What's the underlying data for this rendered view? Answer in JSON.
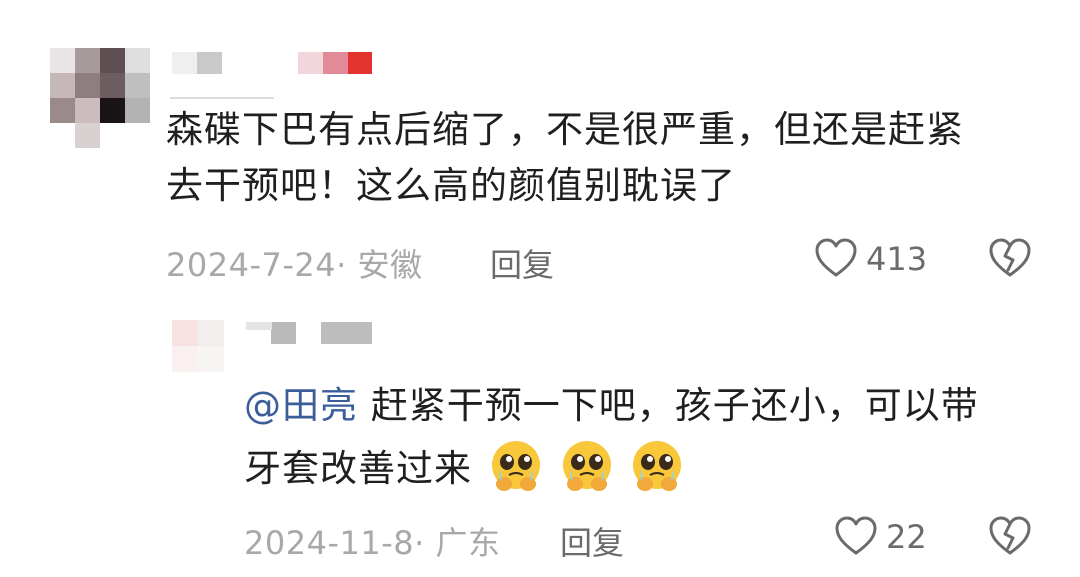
{
  "comment": {
    "text_line1": "森碟下巴有点后缩了，不是很严重，但还是赶紧",
    "text_line2": "去干预吧！这么高的颜值别耽误了",
    "date_location": "2024-7-24· 安徽",
    "reply_label": "回复",
    "like_count": "413",
    "like_icon": "heart-outline",
    "dislike_icon": "broken-heart-outline"
  },
  "reply": {
    "mention": "@田亮",
    "text_line1": " 赶紧干预一下吧，孩子还小，可以带",
    "text_line2": "牙套改善过来",
    "emojis": [
      "pleading-face-emoji",
      "pleading-face-emoji",
      "pleading-face-emoji"
    ],
    "date_location": "2024-11-8· 广东",
    "reply_label": "回复",
    "like_count": "22",
    "like_icon": "heart-outline",
    "dislike_icon": "broken-heart-outline"
  },
  "colors": {
    "text": "#1f1f1f",
    "meta": "#a8a8a8",
    "mention": "#3b5d9a",
    "icon": "#6b6b6b"
  }
}
